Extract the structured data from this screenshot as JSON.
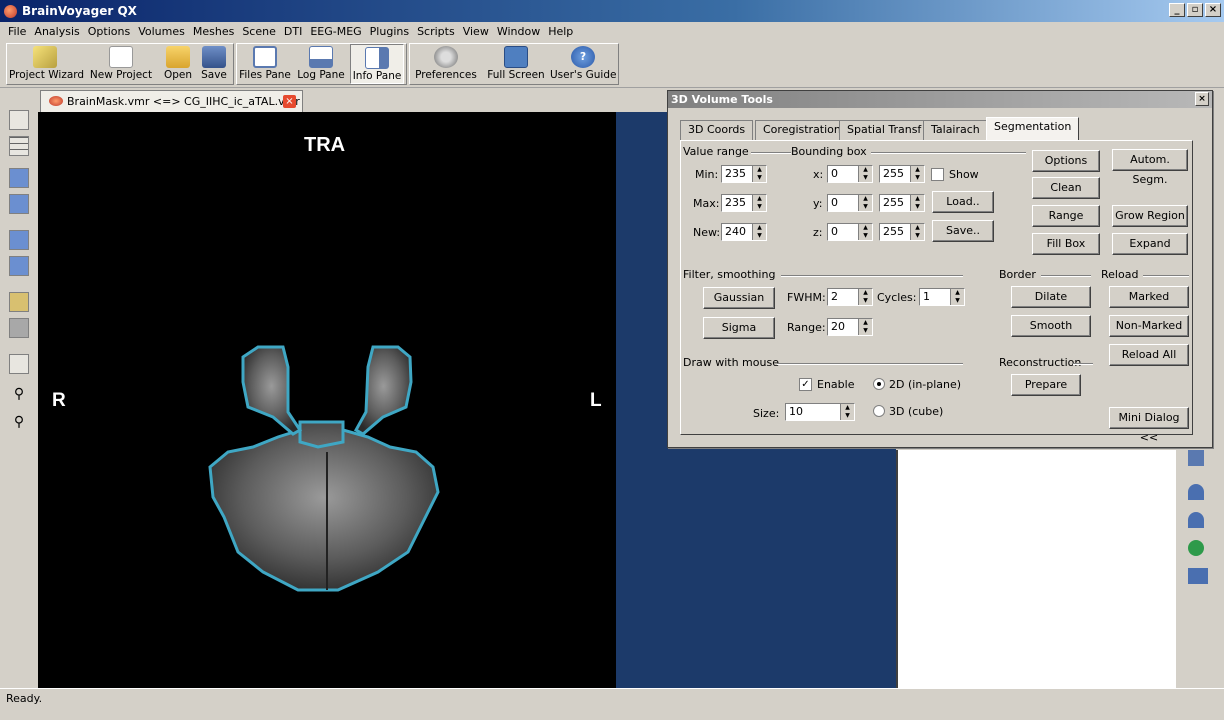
{
  "app": {
    "title": "BrainVoyager QX"
  },
  "menu": [
    "File",
    "Analysis",
    "Options",
    "Volumes",
    "Meshes",
    "Scene",
    "DTI",
    "EEG-MEG",
    "Plugins",
    "Scripts",
    "View",
    "Window",
    "Help"
  ],
  "toolbar": {
    "project_wizard": "Project Wizard",
    "new_project": "New Project",
    "open": "Open",
    "save": "Save",
    "files_pane": "Files Pane",
    "log_pane": "Log Pane",
    "info_pane": "Info Pane",
    "preferences": "Preferences",
    "full_screen": "Full Screen",
    "users_guide": "User's Guide"
  },
  "document": {
    "tab_title": "BrainMask.vmr  <=>  CG_IIHC_ic_aTAL.vmr"
  },
  "viewer": {
    "orientation": "TRA",
    "left_label": "R",
    "right_label": "L"
  },
  "dialog": {
    "title": "3D Volume Tools",
    "tabs": [
      "3D Coords",
      "Coregistration",
      "Spatial Transf",
      "Talairach",
      "Segmentation"
    ],
    "active_tab": "Segmentation",
    "value_range": {
      "label": "Value range",
      "min_label": "Min:",
      "min": "235",
      "max_label": "Max:",
      "max": "235",
      "new_label": "New:",
      "new": "240"
    },
    "bounding_box": {
      "label": "Bounding box",
      "x_label": "x:",
      "x_from": "0",
      "x_to": "255",
      "y_label": "y:",
      "y_from": "0",
      "y_to": "255",
      "z_label": "z:",
      "z_from": "0",
      "z_to": "255",
      "show_label": "Show",
      "load": "Load..",
      "save": "Save.."
    },
    "buttons": {
      "options": "Options",
      "clean": "Clean",
      "range": "Range",
      "fill_box": "Fill Box",
      "autom_segm": "Autom. Segm.",
      "grow_region": "Grow Region",
      "expand": "Expand"
    },
    "filter": {
      "label": "Filter, smoothing",
      "gaussian": "Gaussian",
      "sigma": "Sigma",
      "fwhm_label": "FWHM:",
      "fwhm": "2",
      "cycles_label": "Cycles:",
      "cycles": "1",
      "range_label": "Range:",
      "range": "20"
    },
    "border": {
      "label": "Border",
      "dilate": "Dilate",
      "smooth": "Smooth"
    },
    "reload": {
      "label": "Reload",
      "marked": "Marked",
      "non_marked": "Non-Marked",
      "reload_all": "Reload All"
    },
    "draw": {
      "label": "Draw with mouse",
      "enable": "Enable",
      "mode_2d": "2D (in-plane)",
      "mode_3d": "3D (cube)",
      "size_label": "Size:",
      "size": "10"
    },
    "reconstruction": {
      "label": "Reconstruction",
      "prepare": "Prepare"
    },
    "mini_dialog": "Mini Dialog <<"
  },
  "status": {
    "text": "Ready."
  },
  "colors": {
    "segmentation_outline": "#3fa7c4",
    "viewer_bg": "#000000",
    "right_pane_bg": "#1c3a6a"
  }
}
